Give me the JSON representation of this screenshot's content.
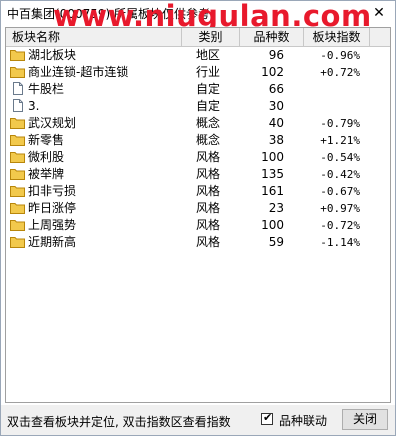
{
  "window": {
    "title": "中百集团(000759)  所属板块仅供参考",
    "watermark": "www.niugulan.com",
    "close_glyph": "✕"
  },
  "table": {
    "columns": [
      "板块名称",
      "类别",
      "品种数",
      "板块指数"
    ],
    "rows": [
      {
        "icon": "folder-icon",
        "name": "湖北板块",
        "category": "地区",
        "count": "96",
        "change": "-0.96%"
      },
      {
        "icon": "folder-icon",
        "name": "商业连锁-超市连锁",
        "category": "行业",
        "count": "102",
        "change": "+0.72%"
      },
      {
        "icon": "document-icon",
        "name": "牛股栏",
        "category": "自定",
        "count": "66",
        "change": ""
      },
      {
        "icon": "document-icon",
        "name": "3.",
        "category": "自定",
        "count": "30",
        "change": ""
      },
      {
        "icon": "folder-icon",
        "name": "武汉规划",
        "category": "概念",
        "count": "40",
        "change": "-0.79%"
      },
      {
        "icon": "folder-icon",
        "name": "新零售",
        "category": "概念",
        "count": "38",
        "change": "+1.21%"
      },
      {
        "icon": "folder-icon",
        "name": "微利股",
        "category": "风格",
        "count": "100",
        "change": "-0.54%"
      },
      {
        "icon": "folder-icon",
        "name": "被举牌",
        "category": "风格",
        "count": "135",
        "change": "-0.42%"
      },
      {
        "icon": "folder-icon",
        "name": "扣非亏损",
        "category": "风格",
        "count": "161",
        "change": "-0.67%"
      },
      {
        "icon": "folder-icon",
        "name": "昨日涨停",
        "category": "风格",
        "count": "23",
        "change": "+0.97%"
      },
      {
        "icon": "folder-icon",
        "name": "上周强势",
        "category": "风格",
        "count": "100",
        "change": "-0.72%"
      },
      {
        "icon": "folder-icon",
        "name": "近期新高",
        "category": "风格",
        "count": "59",
        "change": "-1.14%"
      }
    ]
  },
  "footer": {
    "status_text": "双击查看板块并定位, 双击指数区查看指数",
    "checkbox_label": "品种联动",
    "checkbox_checked": true,
    "close_button": "关闭"
  },
  "colors": {
    "watermark": "#e8192c",
    "folder": "#f2c94c",
    "header_bg": "#f0f0f0"
  }
}
